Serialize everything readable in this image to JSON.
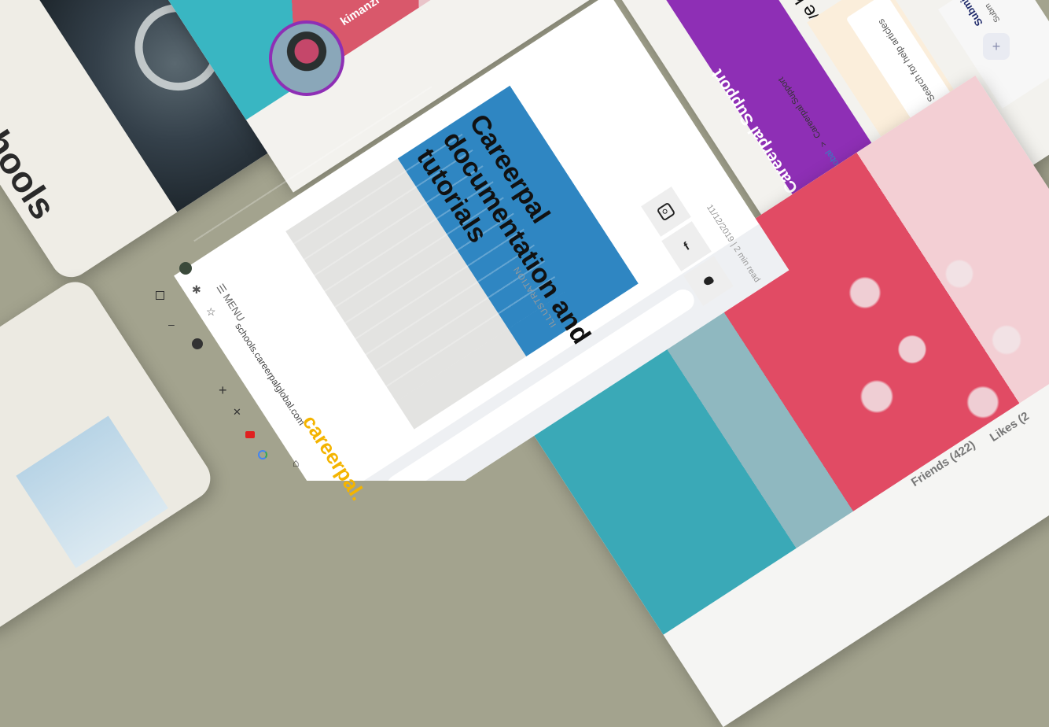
{
  "schools_card": {
    "heading": "al schools"
  },
  "profile_card": {
    "username": "kimanzi"
  },
  "blog_card": {
    "browser": {
      "url": "schools.careerpalglobal.com"
    },
    "menu_label": "MENU",
    "brand_text": "careerpal.",
    "meta": "11/12/2019 | 2 min read",
    "title_lines": [
      "Careerpal",
      "documentation and",
      "tutorials"
    ],
    "category": "ILLUSTRATION",
    "social": [
      {
        "icon": "instagram-icon"
      },
      {
        "icon": "facebook-icon",
        "glyph": "f"
      },
      {
        "icon": "twitter-icon"
      }
    ]
  },
  "support_card": {
    "header_title": "Careerpal Support",
    "breadcrumb_home": "Careerpalglobal",
    "breadcrumb_sep": ">",
    "breadcrumb_current": "Careerpal Support",
    "question": "How can we h",
    "search_placeholder": "Search for help articles",
    "submit_title": "Submi",
    "submit_sub": "Subm"
  },
  "social_tabs": {
    "friends_label": "Friends",
    "friends_count": "(422)",
    "likes_label": "Likes",
    "likes_count": "(2"
  },
  "colors": {
    "background": "#a3a38e",
    "accent_purple": "#8e2fb5",
    "brand_yellow": "#f4b400",
    "brick_blue": "#2f86c2"
  }
}
